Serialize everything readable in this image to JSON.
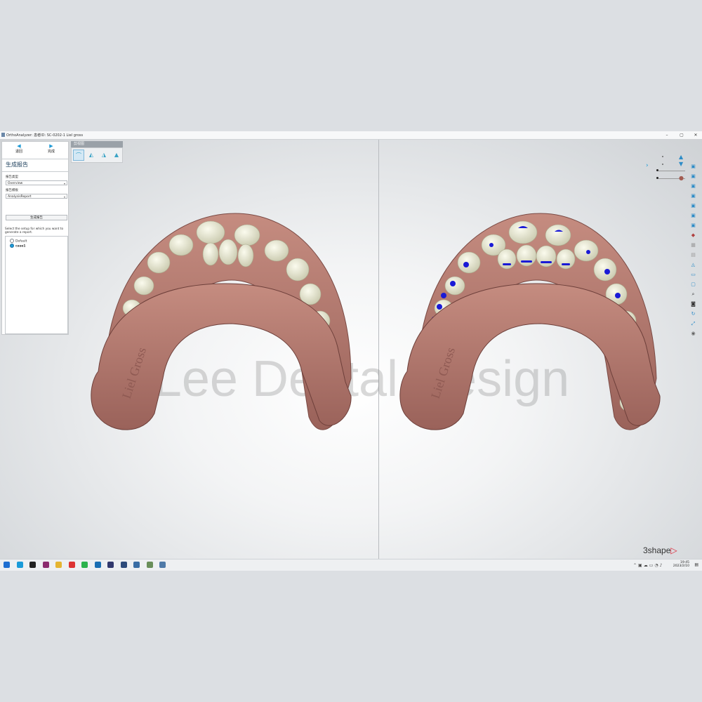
{
  "window": {
    "title": "OrthoAnalyzer: 患者ID: SC-0202-1 Liel gross",
    "min_glyph": "–",
    "max_glyph": "▢",
    "close_glyph": "✕"
  },
  "panel": {
    "back_label": "退回",
    "finish_label": "完成",
    "title": "生成报告",
    "report_type_label": "报告类型",
    "report_type_value": "Overview",
    "report_template_label": "报告模板",
    "report_template_value": "AnalysisReport",
    "generate_button": "生成报告",
    "instructions": "Select the setup for which you want to generate a report.",
    "setups": [
      {
        "label": "Default",
        "selected": false
      },
      {
        "label": "case1",
        "selected": true
      }
    ]
  },
  "view_toolbar": {
    "header": "剪视图",
    "buttons": [
      "arch-front-view",
      "arch-left-view",
      "arch-right-view",
      "arch-top-view"
    ]
  },
  "right_toolbar": {
    "icons": [
      "upper-jaw-icon",
      "lower-jaw-icon",
      "layer-icon",
      "layer-icon",
      "layer-icon",
      "layer-icon",
      "layer-icon",
      "layer-icon",
      "layer-icon",
      "tooth-icon",
      "gum-icon",
      "grid-icon",
      "mesh-icon",
      "attach-icon",
      "ruler-icon",
      "zoom-icon",
      "camera-icon",
      "rotate-icon",
      "fit-icon",
      "sphere-icon"
    ]
  },
  "models": {
    "label_engraving": "Liel Gross",
    "gum_color": "#b57a70",
    "tooth_color": "#e8e8d0",
    "attachment_color": "#1a1ad6"
  },
  "watermark": "Lee Dental Design",
  "brand": "3shape",
  "taskbar": {
    "apps": [
      {
        "icon": "start-icon",
        "color": "#1f6fd1"
      },
      {
        "icon": "edge-icon",
        "color": "#1a9bd9"
      },
      {
        "icon": "obs-icon",
        "color": "#222222"
      },
      {
        "icon": "winrar-icon",
        "color": "#8b2b6e"
      },
      {
        "icon": "folder-icon",
        "color": "#e5b532"
      },
      {
        "icon": "netease-icon",
        "color": "#d33"
      },
      {
        "icon": "wechat-icon",
        "color": "#2bb24c"
      },
      {
        "icon": "app-icon",
        "color": "#1b6fb3"
      },
      {
        "icon": "trios-icon",
        "color": "#333a6e"
      },
      {
        "icon": "remote-icon",
        "color": "#2d4b7a"
      },
      {
        "icon": "network-icon",
        "color": "#3a6ea5"
      },
      {
        "icon": "notes-icon",
        "color": "#6a8f5a"
      },
      {
        "icon": "ortho-icon",
        "color": "#4f7aa8"
      }
    ],
    "time": "19:45",
    "date": "2023/2/10"
  }
}
